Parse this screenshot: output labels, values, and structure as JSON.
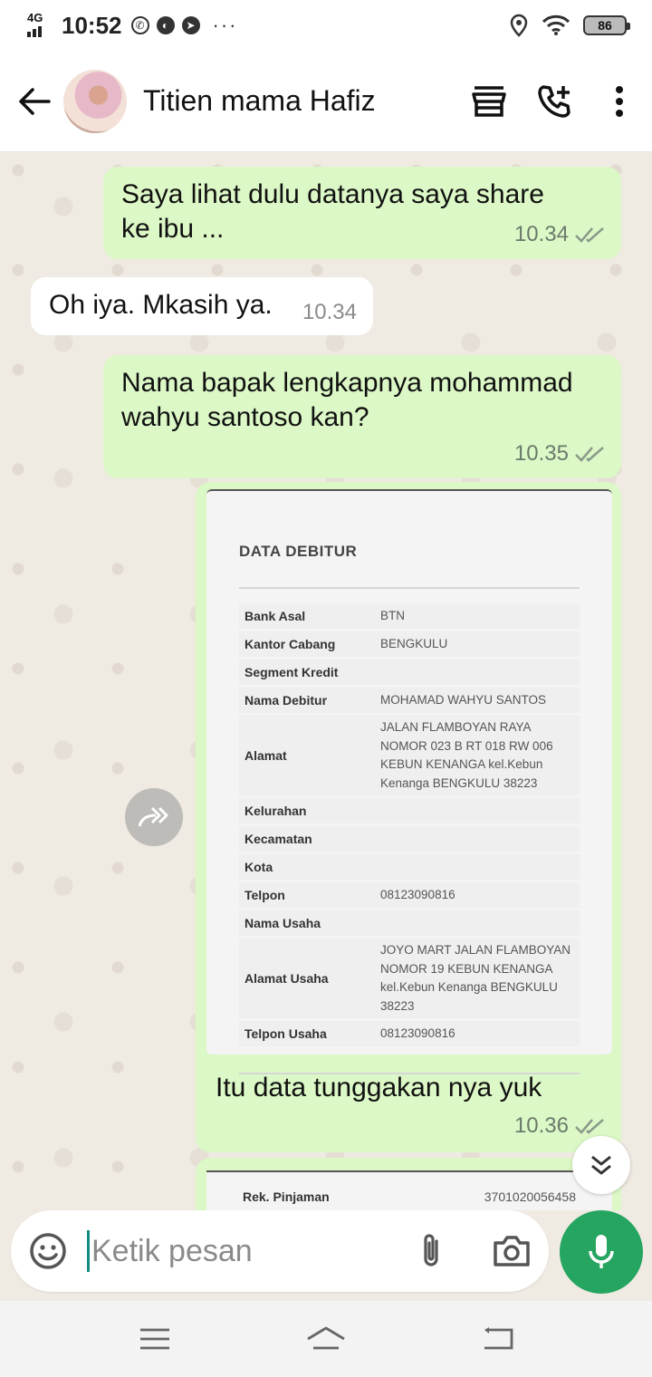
{
  "status_bar": {
    "network": "4G",
    "time": "10:52",
    "more": "···",
    "battery": "86"
  },
  "header": {
    "contact_name": "Titien mama Hafiz"
  },
  "messages": [
    {
      "text": "Saya lihat dulu datanya saya share ke ibu ...",
      "time": "10.34",
      "direction": "out"
    },
    {
      "text": "Oh iya. Mkasih ya.",
      "time": "10.34",
      "direction": "in"
    },
    {
      "text": "Nama bapak lengkapnya mohammad wahyu santoso kan?",
      "time": "10.35",
      "direction": "out"
    },
    {
      "caption": "Itu data tunggakan nya yuk",
      "time": "10.36",
      "direction": "out"
    }
  ],
  "document": {
    "title": "DATA DEBITUR",
    "rows": [
      {
        "label": "Bank Asal",
        "value": "BTN"
      },
      {
        "label": "Kantor Cabang",
        "value": "BENGKULU"
      },
      {
        "label": "Segment Kredit",
        "value": ""
      },
      {
        "label": "Nama Debitur",
        "value": "MOHAMAD WAHYU SANTOS"
      },
      {
        "label": "Alamat",
        "value": "JALAN FLAMBOYAN RAYA NOMOR 023 B RT 018 RW 006 KEBUN KENANGA kel.Kebun Kenanga BENGKULU 38223"
      },
      {
        "label": "Kelurahan",
        "value": ""
      },
      {
        "label": "Kecamatan",
        "value": ""
      },
      {
        "label": "Kota",
        "value": ""
      },
      {
        "label": "Telpon",
        "value": "08123090816"
      },
      {
        "label": "Nama Usaha",
        "value": ""
      },
      {
        "label": "Alamat Usaha",
        "value": "JOYO MART JALAN FLAMBOYAN NOMOR 19 KEBUN KENANGA kel.Kebun Kenanga BENGKULU 38223"
      },
      {
        "label": "Telpon Usaha",
        "value": "08123090816"
      }
    ]
  },
  "document2": {
    "label": "Rek. Pinjaman",
    "value": "3701020056458"
  },
  "input": {
    "placeholder": "Ketik pesan"
  },
  "icons": {
    "back": "arrow-left-icon",
    "store": "store-icon",
    "call": "call-add-icon",
    "menu": "more-vert-icon",
    "emoji": "emoji-icon",
    "attach": "paperclip-icon",
    "camera": "camera-icon",
    "mic": "mic-icon",
    "forward": "forward-icon",
    "scroll": "chevron-double-down-icon"
  },
  "colors": {
    "outgoing": "#dcf8c6",
    "incoming": "#ffffff",
    "accent": "#25a55f",
    "background": "#efeae2"
  }
}
